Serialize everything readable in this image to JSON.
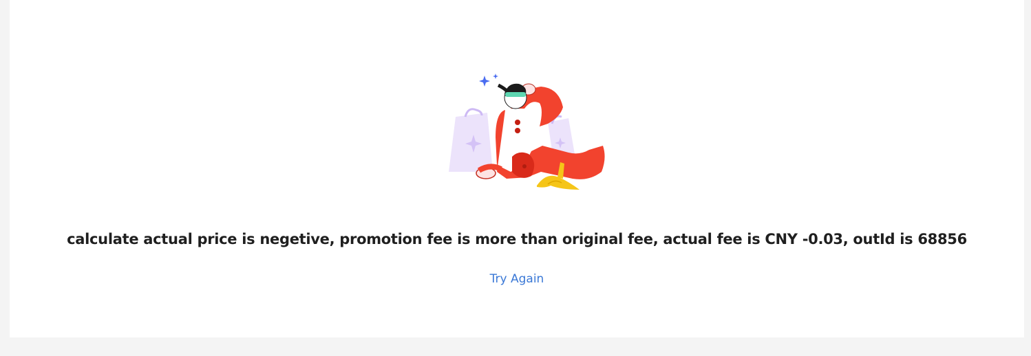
{
  "error": {
    "illustration_icon": "slipped-on-banana-illustration",
    "message": "calculate actual price is negetive, promotion fee is more than original fee, actual fee is CNY -0.03, outId is 68856",
    "retry_label": "Try Again"
  },
  "colors": {
    "page_background": "#f4f4f4",
    "card_background": "#ffffff",
    "message_text": "#1f1f1f",
    "link": "#3a78d6",
    "figure_red": "#f2432e",
    "bag_purple": "#ece3fb",
    "banana_yellow": "#f5c518",
    "sparkle_blue": "#4a6cf0"
  }
}
